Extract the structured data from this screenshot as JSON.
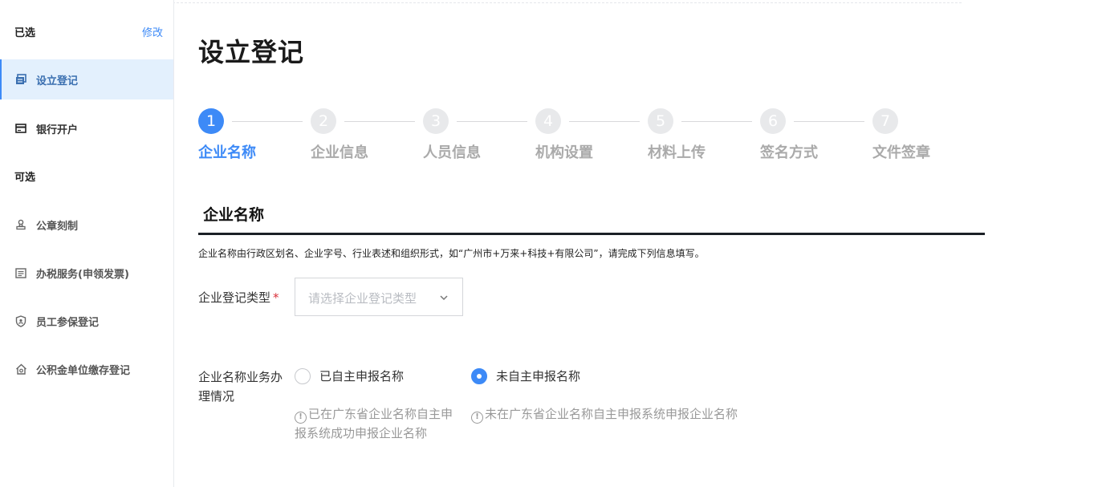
{
  "sidebar": {
    "selected_label": "已选",
    "edit_label": "修改",
    "optional_label": "可选",
    "selected_items": [
      {
        "label": "设立登记",
        "icon": "register-icon",
        "active": true
      },
      {
        "label": "银行开户",
        "icon": "bank-card-icon",
        "active": false
      }
    ],
    "optional_items": [
      {
        "label": "公章刻制",
        "icon": "seal-icon"
      },
      {
        "label": "办税服务(申领发票)",
        "icon": "tax-icon"
      },
      {
        "label": "员工参保登记",
        "icon": "shield-icon"
      },
      {
        "label": "公积金单位缴存登记",
        "icon": "house-icon"
      }
    ]
  },
  "main": {
    "title": "设立登记",
    "steps": [
      {
        "num": "1",
        "label": "企业名称",
        "active": true
      },
      {
        "num": "2",
        "label": "企业信息",
        "active": false
      },
      {
        "num": "3",
        "label": "人员信息",
        "active": false
      },
      {
        "num": "4",
        "label": "机构设置",
        "active": false
      },
      {
        "num": "5",
        "label": "材料上传",
        "active": false
      },
      {
        "num": "6",
        "label": "签名方式",
        "active": false
      },
      {
        "num": "7",
        "label": "文件签章",
        "active": false
      }
    ],
    "section_title": "企业名称",
    "description": "企业名称由行政区划名、企业字号、行业表述和组织形式，如“广州市+万来+科技+有限公司”，请完成下列信息填写。",
    "reg_type": {
      "label": "企业登记类型",
      "required_mark": "*",
      "placeholder": "请选择企业登记类型"
    },
    "name_status": {
      "label_line1": "企业名称业务办",
      "label_line2": "理情况",
      "options": [
        {
          "label": "已自主申报名称",
          "checked": false,
          "hint_line1": "已在广东省企业名称自主申",
          "hint_line2": "报系统成功申报企业名称"
        },
        {
          "label": "未自主申报名称",
          "checked": true,
          "hint_line1": "未在广东省企业名称自主申报系统申报企业名称"
        }
      ],
      "info_glyph": "!"
    },
    "colors": {
      "accent": "#3d8af7",
      "required": "#d9303a",
      "active_bg": "#e3f0fd"
    }
  }
}
